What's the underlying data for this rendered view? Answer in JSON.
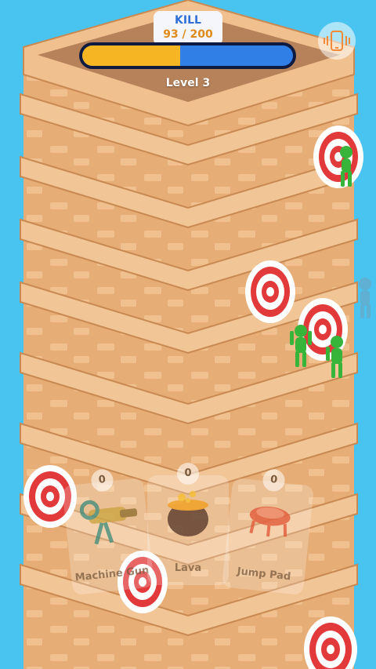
{
  "hud": {
    "kill_label": "KILL",
    "kill_count": "93 / 200",
    "kill_progress": 0.465,
    "level_label": "Level 3"
  },
  "vibration_button": {
    "icon": "phone-vibrate-icon"
  },
  "cards": [
    {
      "count": "0",
      "label": "Machine Gun",
      "icon": "machine-gun-icon"
    },
    {
      "count": "0",
      "label": "Lava",
      "icon": "lava-cauldron-icon"
    },
    {
      "count": "0",
      "label": "Jump Pad",
      "icon": "jump-pad-icon"
    }
  ],
  "colors": {
    "sky": "#49c3ef",
    "brick": "#e8b07a",
    "enemy": "#37b43a",
    "target_red": "#e23a3a",
    "bar_fill": "#f6b522",
    "bar_track": "#2f7fe6"
  }
}
